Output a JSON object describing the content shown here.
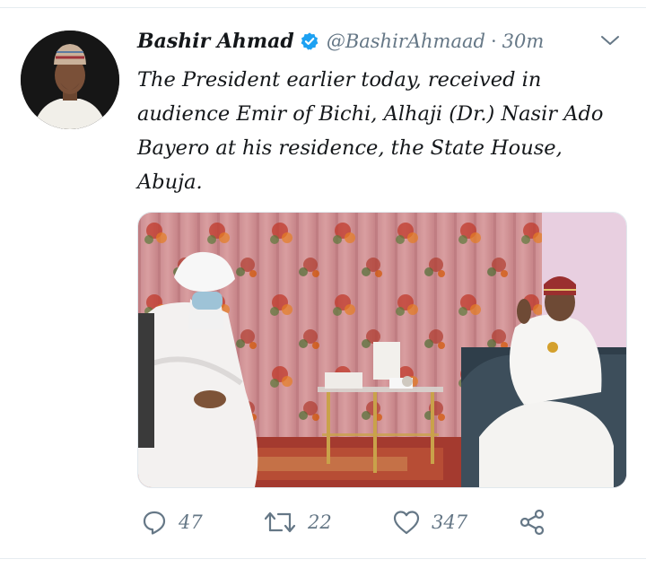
{
  "tweet": {
    "author": {
      "display_name": "Bashir Ahmad",
      "handle": "@BashirAhmaad",
      "verified": true
    },
    "separator": "·",
    "time": "30m",
    "text": "The President earlier today, received in audience Emir of Bichi, Alhaji (Dr.) Nasir Ado Bayero at his residence, the State House, Abuja."
  },
  "actions": {
    "reply_count": "47",
    "retweet_count": "22",
    "like_count": "347"
  },
  "icons": {
    "verified": "verified-badge-icon",
    "more": "chevron-down-icon",
    "reply": "reply-icon",
    "retweet": "retweet-icon",
    "like": "heart-icon",
    "share": "share-icon"
  },
  "colors": {
    "accent": "#1da1f2",
    "muted": "#657786",
    "text": "#14171a"
  }
}
